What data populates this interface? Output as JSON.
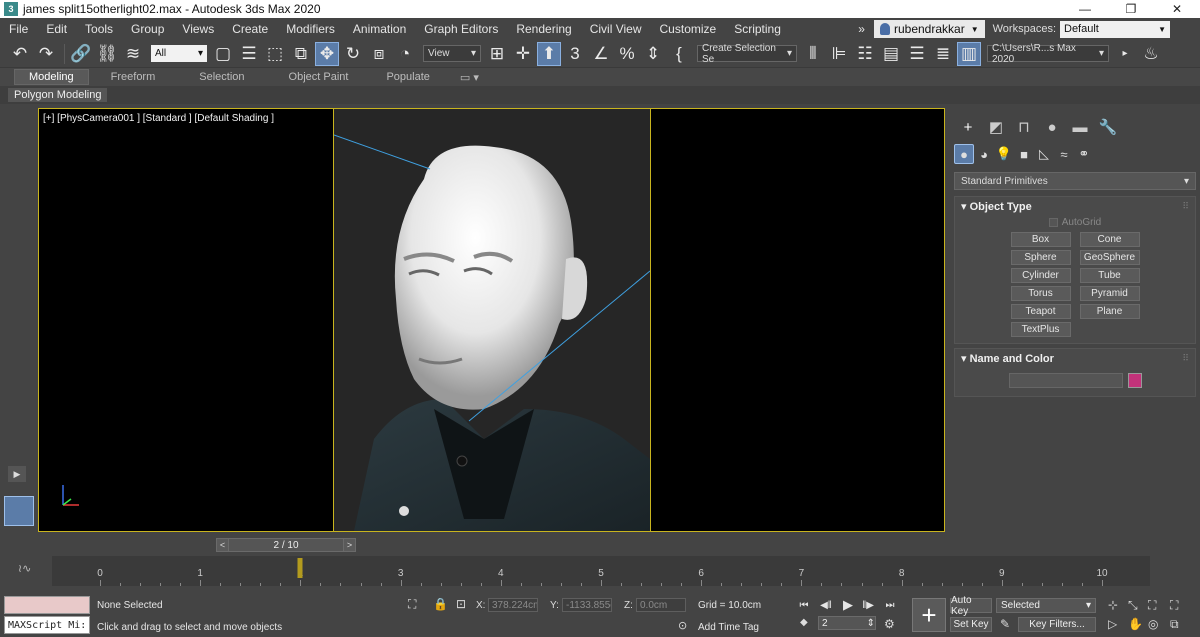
{
  "window": {
    "title": "james split15otherlight02.max - Autodesk 3ds Max 2020",
    "app_icon": "3"
  },
  "menu": {
    "items": [
      "File",
      "Edit",
      "Tools",
      "Group",
      "Views",
      "Create",
      "Modifiers",
      "Animation",
      "Graph Editors",
      "Rendering",
      "Civil View",
      "Customize",
      "Scripting"
    ],
    "overflow": "»",
    "user": "rubendrakkar",
    "workspaces_label": "Workspaces:",
    "workspace_value": "Default"
  },
  "toolbar": {
    "selection_filter": "All",
    "ref_coord": "View",
    "named_selection": "Create Selection Se",
    "project_path": "C:\\Users\\R...s Max 2020"
  },
  "ribbon": {
    "tabs": [
      "Modeling",
      "Freeform",
      "Selection",
      "Object Paint",
      "Populate"
    ],
    "active_tab": "Modeling",
    "sub_label": "Polygon Modeling"
  },
  "viewport": {
    "label": "[+] [PhysCamera001 ] [Standard ] [Default Shading ]"
  },
  "command_panel": {
    "category": "Standard Primitives",
    "object_type_title": "Object Type",
    "autogrid": "AutoGrid",
    "primitives": [
      "Box",
      "Cone",
      "Sphere",
      "GeoSphere",
      "Cylinder",
      "Tube",
      "Torus",
      "Pyramid",
      "Teapot",
      "Plane",
      "TextPlus"
    ],
    "name_color_title": "Name and Color",
    "object_color": "#c2327a"
  },
  "timeline": {
    "frame_display": "2 / 10",
    "ticks": [
      "0",
      "1",
      "2",
      "3",
      "4",
      "5",
      "6",
      "7",
      "8",
      "9",
      "10"
    ],
    "current_frame": 2,
    "total_frames": 10
  },
  "status": {
    "maxscript_label": "MAXScript Mi:",
    "selection_status": "None Selected",
    "prompt": "Click and drag to select and move objects",
    "x_label": "X:",
    "x_value": "378.224cm",
    "y_label": "Y:",
    "y_value": "-1133.855c",
    "z_label": "Z:",
    "z_value": "0.0cm",
    "grid": "Grid = 10.0cm",
    "add_time_tag": "Add Time Tag",
    "current_frame": "2",
    "auto_key": "Auto Key",
    "set_key": "Set Key",
    "key_mode": "Selected",
    "key_filters": "Key Filters..."
  },
  "colors": {
    "viewport_border": "#c8b41e",
    "active_button": "#5b7ca8"
  }
}
